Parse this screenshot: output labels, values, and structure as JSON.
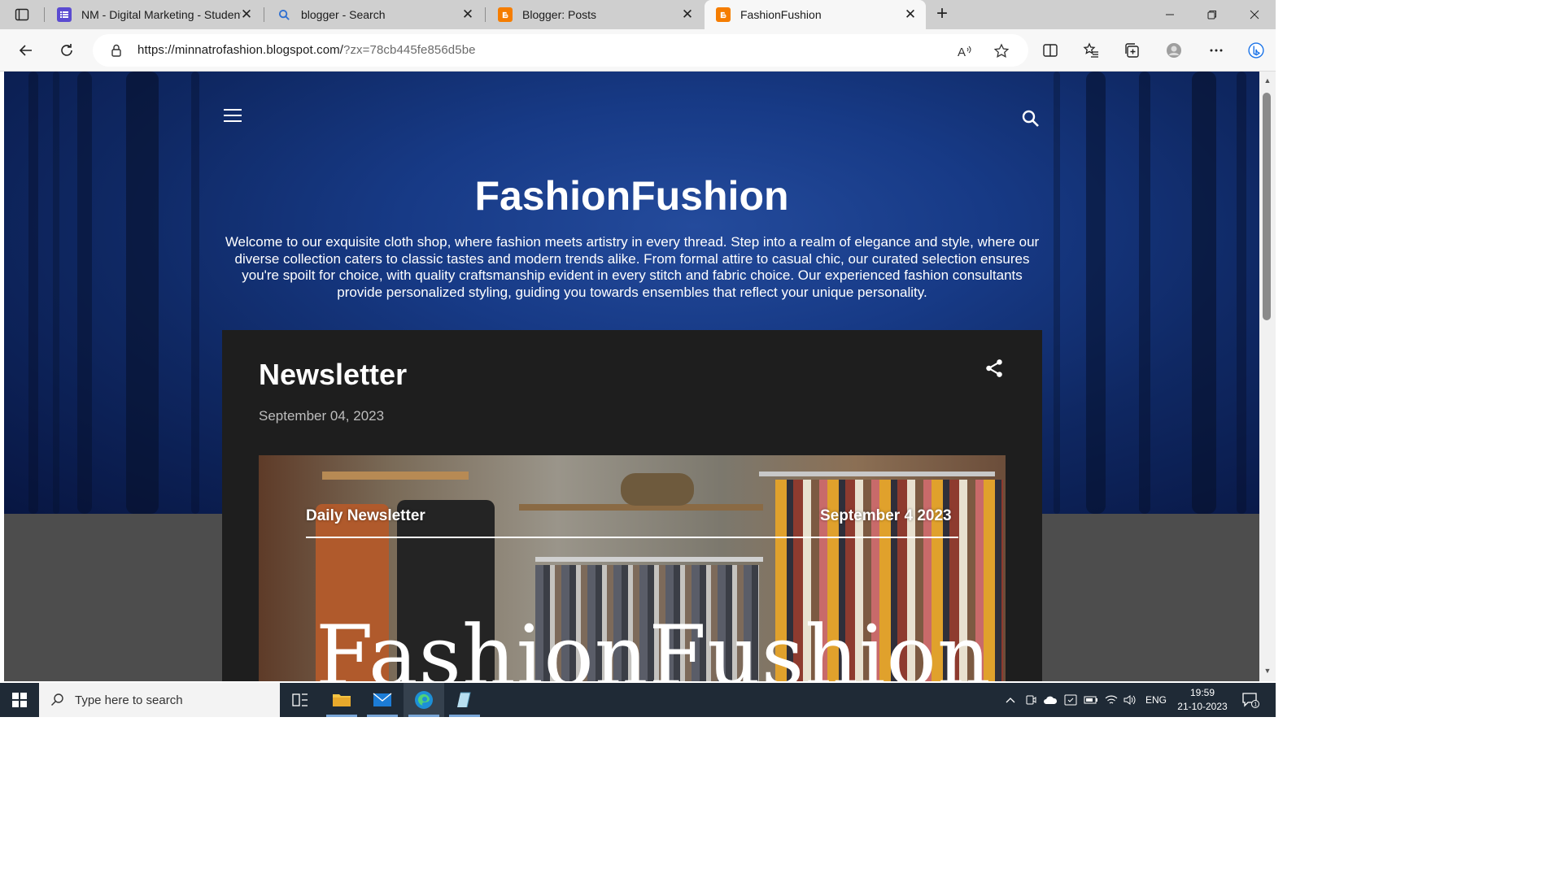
{
  "browser": {
    "tabs": [
      {
        "title": "NM - Digital Marketing - Student",
        "icon": "list-icon",
        "color": "#5b4bd1"
      },
      {
        "title": "blogger - Search",
        "icon": "search-icon",
        "color": "#2e6fd1"
      },
      {
        "title": "Blogger: Posts",
        "icon": "blogger-icon",
        "color": "#f57d00"
      },
      {
        "title": "FashionFushion",
        "icon": "blogger-icon",
        "color": "#f57d00",
        "active": true
      }
    ],
    "url_host": "https://minnatrofashion.blogspot.com/",
    "url_query": "?zx=78cb445fe856d5be"
  },
  "blog": {
    "title": "FashionFushion",
    "description": "Welcome to our exquisite cloth shop, where fashion meets artistry in every thread. Step into a realm of elegance and style, where our diverse collection caters to classic tastes and modern trends alike. From formal attire to casual chic, our curated selection ensures you're spoilt for choice, with quality craftsmanship evident in every stitch and fabric choice. Our experienced fashion consultants provide personalized styling, guiding you towards ensembles that reflect your unique personality."
  },
  "post": {
    "title": "Newsletter",
    "date": "September 04, 2023",
    "image": {
      "label_left": "Daily Newsletter",
      "label_right": "September 4 2023",
      "big_text": "FashionFushion"
    }
  },
  "taskbar": {
    "search_placeholder": "Type here to search",
    "language": "ENG",
    "time": "19:59",
    "date": "21-10-2023",
    "notification_count": "1"
  },
  "colors": {
    "hero_blue": "#173a86",
    "post_bg": "#1e1e1e",
    "taskbar": "#1f2a36"
  }
}
